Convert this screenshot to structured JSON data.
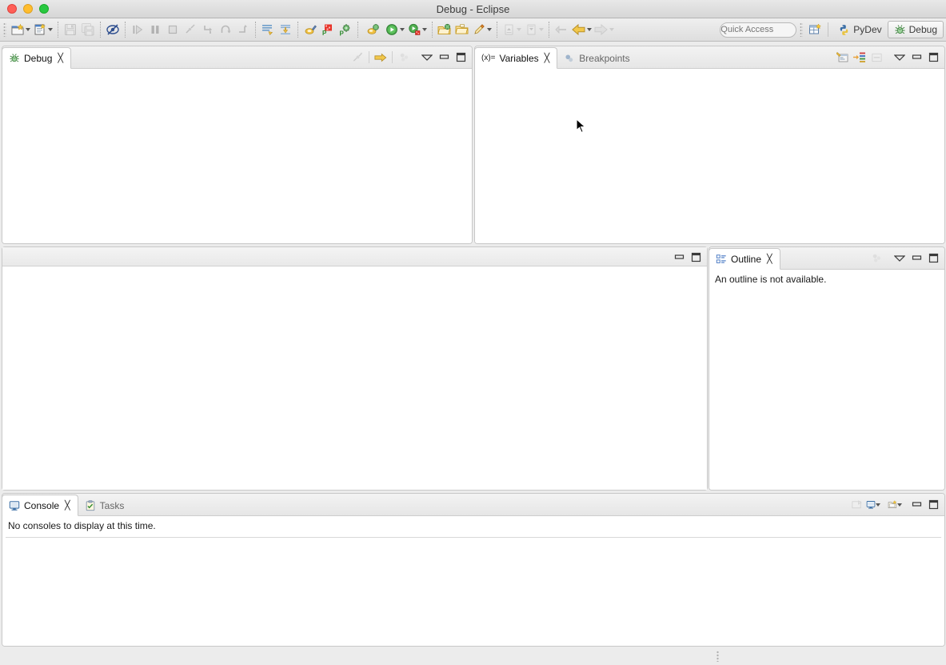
{
  "window": {
    "title": "Debug - Eclipse",
    "traffic_lights": [
      "close",
      "minimize",
      "zoom"
    ]
  },
  "toolbar": {
    "groups": [
      {
        "name": "file",
        "buttons": [
          {
            "name": "new-wizard-button",
            "icon": "new-file-icon",
            "label": "New",
            "enabled": true,
            "dropdown": true
          },
          {
            "name": "new-item-button",
            "icon": "new-item-icon",
            "label": "New Item",
            "enabled": true,
            "dropdown": true
          }
        ]
      },
      {
        "name": "save",
        "buttons": [
          {
            "name": "save-button",
            "icon": "save-icon",
            "label": "Save",
            "enabled": false,
            "dropdown": false
          },
          {
            "name": "save-all-button",
            "icon": "save-all-icon",
            "label": "Save All",
            "enabled": false,
            "dropdown": false
          }
        ]
      },
      {
        "name": "breakpoints",
        "buttons": [
          {
            "name": "skip-breakpoints-button",
            "icon": "skip-breakpoints-icon",
            "label": "Skip All Breakpoints",
            "enabled": true,
            "dropdown": false
          }
        ]
      },
      {
        "name": "debug-controls",
        "buttons": [
          {
            "name": "resume-button",
            "icon": "resume-icon",
            "label": "Resume",
            "enabled": false,
            "dropdown": false
          },
          {
            "name": "suspend-button",
            "icon": "suspend-icon",
            "label": "Suspend",
            "enabled": false,
            "dropdown": false
          },
          {
            "name": "terminate-button",
            "icon": "terminate-icon",
            "label": "Terminate",
            "enabled": false,
            "dropdown": false
          },
          {
            "name": "disconnect-button",
            "icon": "disconnect-icon",
            "label": "Disconnect",
            "enabled": false,
            "dropdown": false
          },
          {
            "name": "step-into-button",
            "icon": "step-into-icon",
            "label": "Step Into",
            "enabled": false,
            "dropdown": false
          },
          {
            "name": "step-over-button",
            "icon": "step-over-icon",
            "label": "Step Over",
            "enabled": false,
            "dropdown": false
          },
          {
            "name": "step-return-button",
            "icon": "step-return-icon",
            "label": "Step Return",
            "enabled": false,
            "dropdown": false
          }
        ]
      },
      {
        "name": "pydev-actions",
        "buttons": [
          {
            "name": "code-coverage-button",
            "icon": "code-analysis-icon",
            "label": "Code Analysis",
            "enabled": true,
            "dropdown": false
          },
          {
            "name": "pydev-package-explorer-button",
            "icon": "pydev-import-icon",
            "label": "PyDev Import",
            "enabled": true,
            "dropdown": false
          }
        ]
      },
      {
        "name": "pydev-tools",
        "buttons": [
          {
            "name": "open-python-file-button",
            "icon": "python-file-icon",
            "label": "Open Python File",
            "enabled": true,
            "dropdown": false
          },
          {
            "name": "pylint-button",
            "icon": "pylint-icon",
            "label": "PyLint",
            "enabled": true,
            "dropdown": false
          },
          {
            "name": "pydev-config-button",
            "icon": "pydev-config-icon",
            "label": "PyDev Configuration",
            "enabled": true,
            "dropdown": false
          }
        ]
      },
      {
        "name": "launch",
        "buttons": [
          {
            "name": "debug-launch-button",
            "icon": "debug-bug-icon",
            "label": "Debug",
            "enabled": true,
            "dropdown": true
          },
          {
            "name": "run-launch-button",
            "icon": "run-play-icon",
            "label": "Run",
            "enabled": true,
            "dropdown": true
          },
          {
            "name": "coverage-launch-button",
            "icon": "coverage-icon",
            "label": "Coverage",
            "enabled": true,
            "dropdown": true
          }
        ]
      },
      {
        "name": "resources",
        "buttons": [
          {
            "name": "open-type-button",
            "icon": "open-folder-green-icon",
            "label": "Open Type",
            "enabled": true,
            "dropdown": false
          },
          {
            "name": "open-resource-button",
            "icon": "open-folder-icon",
            "label": "Open Resource",
            "enabled": true,
            "dropdown": false
          },
          {
            "name": "external-tools-button",
            "icon": "external-tools-icon",
            "label": "External Tools",
            "enabled": true,
            "dropdown": true
          }
        ]
      },
      {
        "name": "annotations",
        "buttons": [
          {
            "name": "previous-annotation-button",
            "icon": "previous-annotation-icon",
            "label": "Previous Annotation",
            "enabled": false,
            "dropdown": true
          },
          {
            "name": "next-annotation-button",
            "icon": "next-annotation-icon",
            "label": "Next Annotation",
            "enabled": false,
            "dropdown": true
          }
        ]
      },
      {
        "name": "history",
        "buttons": [
          {
            "name": "last-edit-location-button",
            "icon": "last-edit-location-icon",
            "label": "Last Edit Location",
            "enabled": false,
            "dropdown": false
          },
          {
            "name": "back-button",
            "icon": "back-arrow-icon",
            "label": "Back",
            "enabled": true,
            "dropdown": true
          },
          {
            "name": "forward-button",
            "icon": "forward-arrow-icon",
            "label": "Forward",
            "enabled": false,
            "dropdown": true
          }
        ]
      }
    ],
    "quick_access": {
      "placeholder": "Quick Access",
      "value": ""
    },
    "open_perspective": {
      "name": "open-perspective-button",
      "label": "Open Perspective"
    },
    "perspectives": [
      {
        "name": "perspective-pydev",
        "label": "PyDev",
        "icon": "python-icon",
        "active": false
      },
      {
        "name": "perspective-debug",
        "label": "Debug",
        "icon": "bug-icon",
        "active": true
      }
    ]
  },
  "views": {
    "debug": {
      "tabs": [
        {
          "label": "Debug",
          "icon": "bug-icon",
          "active": true,
          "closeable": true
        }
      ],
      "tools": [
        {
          "name": "disconnect-all-button",
          "icon": "disconnect-icon",
          "enabled": false
        },
        {
          "name": "step-return-yellow-button",
          "icon": "yellow-arrow-icon",
          "enabled": true
        },
        {
          "name": "view-filter-button",
          "icon": "filter-dots-icon",
          "enabled": false
        },
        {
          "name": "view-menu-button",
          "icon": "chevron-down-icon",
          "enabled": true
        },
        {
          "name": "minimize-button",
          "icon": "minimize-icon",
          "enabled": true
        },
        {
          "name": "maximize-button",
          "icon": "maximize-icon",
          "enabled": true
        }
      ],
      "content": ""
    },
    "variables": {
      "tabs": [
        {
          "label": "Variables",
          "icon": "variables-icon",
          "active": true,
          "closeable": true
        },
        {
          "label": "Breakpoints",
          "icon": "breakpoints-icon",
          "active": false,
          "closeable": false
        }
      ],
      "tools": [
        {
          "name": "show-type-names-button",
          "icon": "show-type-names-icon",
          "enabled": true
        },
        {
          "name": "collapse-all-button",
          "icon": "collapse-all-icon",
          "enabled": true
        },
        {
          "name": "show-logical-structure-button",
          "icon": "logical-structure-icon",
          "enabled": false
        },
        {
          "name": "view-menu-button",
          "icon": "chevron-down-icon",
          "enabled": true
        },
        {
          "name": "minimize-button",
          "icon": "minimize-icon",
          "enabled": true
        },
        {
          "name": "maximize-button",
          "icon": "maximize-icon",
          "enabled": true
        }
      ],
      "content": ""
    },
    "editor": {
      "tools": [
        {
          "name": "minimize-button",
          "icon": "minimize-icon",
          "enabled": true
        },
        {
          "name": "maximize-button",
          "icon": "maximize-icon",
          "enabled": true
        }
      ],
      "content": ""
    },
    "outline": {
      "tabs": [
        {
          "label": "Outline",
          "icon": "outline-icon",
          "active": true,
          "closeable": true
        }
      ],
      "tools": [
        {
          "name": "view-filter-button",
          "icon": "filter-dots-icon",
          "enabled": false
        },
        {
          "name": "view-menu-button",
          "icon": "chevron-down-icon",
          "enabled": true
        },
        {
          "name": "minimize-button",
          "icon": "minimize-icon",
          "enabled": true
        },
        {
          "name": "maximize-button",
          "icon": "maximize-icon",
          "enabled": true
        }
      ],
      "message": "An outline is not available."
    },
    "console": {
      "tabs": [
        {
          "label": "Console",
          "icon": "console-icon",
          "active": true,
          "closeable": true
        },
        {
          "label": "Tasks",
          "icon": "tasks-icon",
          "active": false,
          "closeable": false
        }
      ],
      "tools": [
        {
          "name": "pin-console-button",
          "icon": "pin-console-icon",
          "enabled": false
        },
        {
          "name": "display-selected-console-button",
          "icon": "display-console-icon",
          "enabled": true,
          "dropdown": true
        },
        {
          "name": "open-console-button",
          "icon": "open-console-icon",
          "enabled": true,
          "dropdown": true
        },
        {
          "name": "minimize-button",
          "icon": "minimize-icon",
          "enabled": true
        },
        {
          "name": "maximize-button",
          "icon": "maximize-icon",
          "enabled": true
        }
      ],
      "message": "No consoles to display at this time."
    }
  },
  "statusbar": {
    "text": ""
  },
  "colors": {
    "accent_yellow": "#e8b93c",
    "window_bg": "#ececec",
    "panel_bg": "#ffffff",
    "border": "#c8c8c8",
    "text": "#1a1a1a",
    "text_muted": "#808080"
  }
}
